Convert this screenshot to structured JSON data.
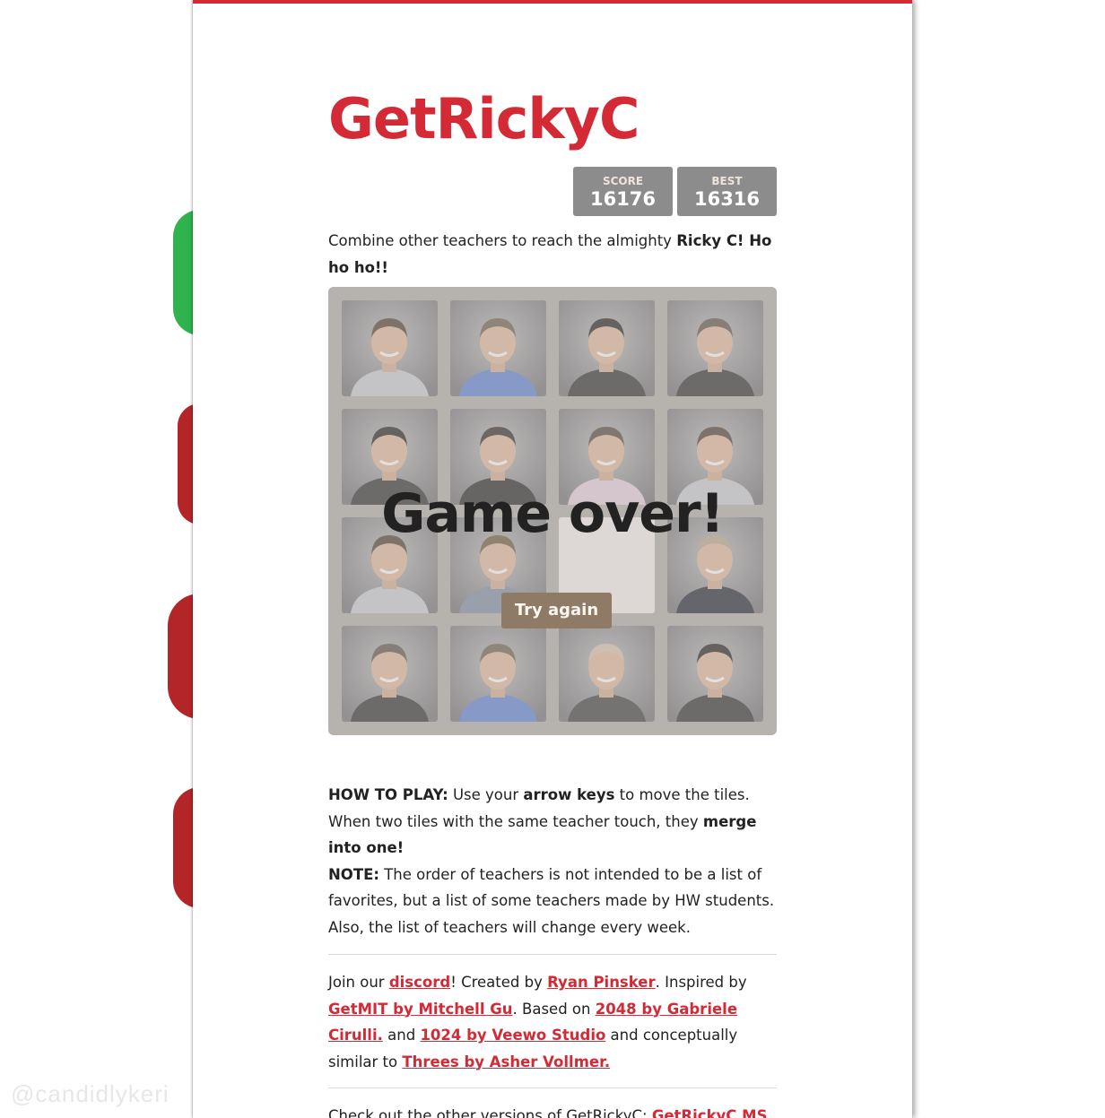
{
  "app": {
    "title": "GetRickyC",
    "accent_color": "#d42a35",
    "watermark": "@candidlykeri"
  },
  "scores": {
    "score_label": "SCORE",
    "score_value": "16176",
    "best_label": "BEST",
    "best_value": "16316"
  },
  "intro": {
    "text": "Combine other teachers to reach the almighty ",
    "bold": "Ricky C! Ho ho ho!!"
  },
  "board": {
    "status": "Game over!",
    "retry_label": "Try again",
    "tiles": [
      {
        "row": 1,
        "col": 1,
        "kind": "teacher-photo",
        "shirt": "#c9cdd6",
        "hair": "#4a3a2e"
      },
      {
        "row": 1,
        "col": 2,
        "kind": "teacher-photo",
        "shirt": "#5a7ed6",
        "hair": "#6a5a48"
      },
      {
        "row": 1,
        "col": 3,
        "kind": "teacher-photo",
        "shirt": "#2a2a2a",
        "hair": "#1c1a1a"
      },
      {
        "row": 1,
        "col": 4,
        "kind": "teacher-photo",
        "shirt": "#2b2b2b",
        "hair": "#5a4e44"
      },
      {
        "row": 2,
        "col": 1,
        "kind": "teacher-photo",
        "shirt": "#2a2a2a",
        "hair": "#1c1a1a"
      },
      {
        "row": 2,
        "col": 2,
        "kind": "teacher-photo",
        "shirt": "#1f1f1f",
        "hair": "#2a2422"
      },
      {
        "row": 2,
        "col": 3,
        "kind": "teacher-photo",
        "shirt": "#e7cfe0",
        "hair": "#4e4238"
      },
      {
        "row": 2,
        "col": 4,
        "kind": "teacher-photo",
        "shirt": "#c9cdd6",
        "hair": "#4a3a2e"
      },
      {
        "row": 3,
        "col": 1,
        "kind": "teacher-photo",
        "shirt": "#c9cdd6",
        "hair": "#4a3a2e"
      },
      {
        "row": 3,
        "col": 2,
        "kind": "teacher-photo",
        "shirt": "#7b8aa2",
        "hair": "#6a5438"
      },
      {
        "row": 3,
        "col": 3,
        "kind": "empty",
        "shirt": "",
        "hair": ""
      },
      {
        "row": 3,
        "col": 4,
        "kind": "teacher-photo",
        "shirt": "#1c2230",
        "hair": "#b7a58f"
      },
      {
        "row": 4,
        "col": 1,
        "kind": "teacher-photo",
        "shirt": "#2b2b2b",
        "hair": "#5a4e44"
      },
      {
        "row": 4,
        "col": 2,
        "kind": "teacher-photo",
        "shirt": "#5a7ed6",
        "hair": "#6a5a48"
      },
      {
        "row": 4,
        "col": 3,
        "kind": "teacher-photo",
        "shirt": "#3a3a3a",
        "hair": "#d9c2b0"
      },
      {
        "row": 4,
        "col": 4,
        "kind": "teacher-photo",
        "shirt": "#2a2a2a",
        "hair": "#1c1a1a"
      }
    ]
  },
  "howto": {
    "label1": "HOW TO PLAY:",
    "t1": " Use your ",
    "b1": "arrow keys",
    "t2": " to move the tiles. When two tiles with the same teacher touch, they ",
    "b2": "merge into one!",
    "label2": "NOTE:",
    "t3": " The order of teachers is not intended to be a list of favorites, but a list of some teachers made by HW students. Also, the list of teachers will change every week."
  },
  "credits": {
    "t1": "Join our ",
    "link_discord": "discord",
    "t2": "! Created by ",
    "link_author": "Ryan Pinsker",
    "t3": ". Inspired by ",
    "link_getmit": "GetMIT by Mitchell Gu",
    "t4": ". Based on ",
    "link_2048": "2048 by Gabriele Cirulli.",
    "t5": " and ",
    "link_1024": "1024 by Veewo Studio",
    "t6": " and conceptually similar to ",
    "link_threes": "Threes by Asher Vollmer."
  },
  "others": {
    "text": "Check out the other versions of GetRickyC: ",
    "link": "GetRickyC MS"
  }
}
